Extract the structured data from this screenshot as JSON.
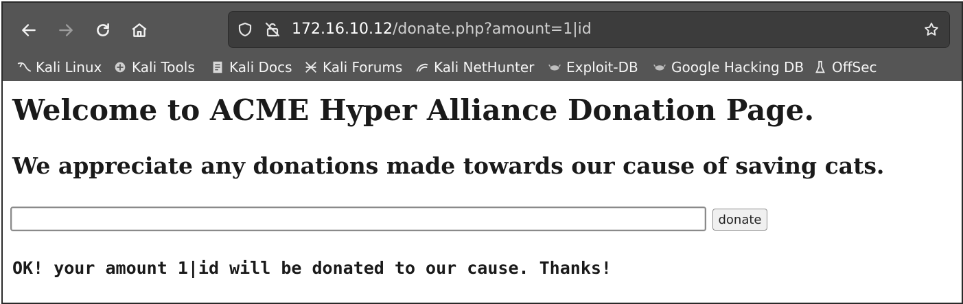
{
  "browser": {
    "url": {
      "host": "172.16.10.12",
      "path": "/donate.php?amount=1|id"
    },
    "nav": {
      "back_icon": "arrow-left-icon",
      "forward_icon": "arrow-right-icon",
      "reload_icon": "reload-icon",
      "home_icon": "home-icon"
    },
    "bookmarks": [
      {
        "label": "Kali Linux",
        "icon": "kali-dragon-icon"
      },
      {
        "label": "Kali Tools",
        "icon": "kali-tools-icon"
      },
      {
        "label": "Kali Docs",
        "icon": "kali-docs-icon"
      },
      {
        "label": "Kali Forums",
        "icon": "kali-forums-icon"
      },
      {
        "label": "Kali NetHunter",
        "icon": "kali-nethunter-icon"
      },
      {
        "label": "Exploit-DB",
        "icon": "exploit-db-icon"
      },
      {
        "label": "Google Hacking DB",
        "icon": "ghdb-icon"
      },
      {
        "label": "OffSec",
        "icon": "offsec-icon"
      }
    ]
  },
  "page": {
    "heading": "Welcome to ACME Hyper Alliance Donation Page.",
    "subheading": "We appreciate any donations made towards our cause of saving cats.",
    "amount_input_value": "",
    "donate_label": "donate",
    "result_text": "OK! your amount 1|id will be donated to our cause. Thanks!"
  }
}
